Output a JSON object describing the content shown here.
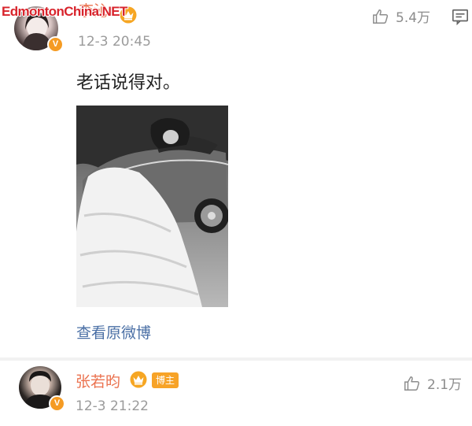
{
  "watermark": "EdmontonChina.NET",
  "post": {
    "author": "李沁",
    "verified_icon": "v-badge-icon",
    "crown_icon": "crown-icon",
    "timestamp": "12-3 20:45",
    "likes": "5.4万",
    "text": "老话说得对。",
    "photo_alt": "wedding-photo-bw",
    "view_original": "查看原微博",
    "colors": {
      "name": "#eb7350",
      "link": "#4a6fa5",
      "badge": "#f59b23"
    }
  },
  "reply": {
    "author": "张若昀",
    "badge": "博主",
    "timestamp": "12-3 21:22",
    "likes": "2.1万"
  }
}
